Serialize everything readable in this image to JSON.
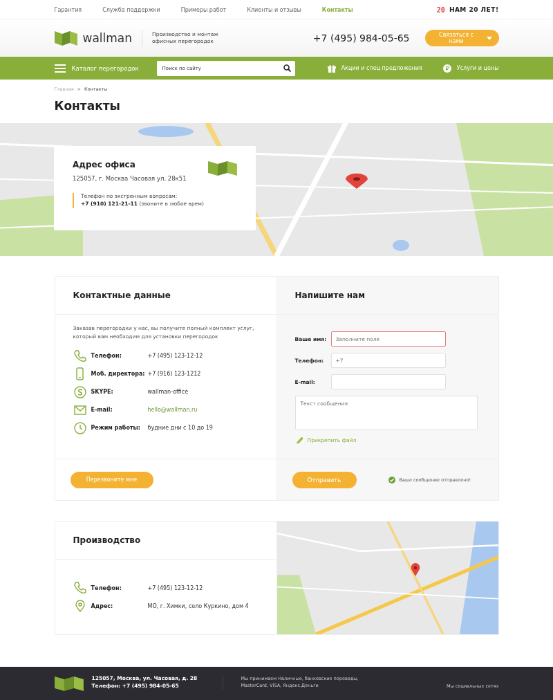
{
  "top_nav": {
    "items": [
      {
        "label": "Гарантия",
        "selected": false
      },
      {
        "label": "Служба поддержки",
        "selected": false
      },
      {
        "label": "Примеры работ",
        "selected": false
      },
      {
        "label": "Клиенты и отзывы",
        "selected": false
      },
      {
        "label": "Контакты",
        "selected": true
      }
    ],
    "anniversary": {
      "badge": "20",
      "text": "НАМ 20 ЛЕТ!"
    }
  },
  "header": {
    "logo_text": "wallman",
    "tagline": "Производство и монтаж офисных перегородок",
    "phone": "+7 (495) 984-05-65",
    "contact_button": "Связаться с нами"
  },
  "nav_bar": {
    "catalog": "Каталог перегородок",
    "search": {
      "placeholder": "Поиск по сайту"
    },
    "links": [
      {
        "label": "Акции и спец предложения",
        "kind": "gift"
      },
      {
        "label": "Услуги и цены",
        "kind": "ruble"
      }
    ]
  },
  "breadcrumb": [
    {
      "label": "Главная",
      "selected": false
    },
    {
      "label": "Контакты",
      "selected": true
    }
  ],
  "breadcrumb_separator": ">",
  "page_title": "Контакты",
  "office_card": {
    "title": "Адрес офиса",
    "address": "125057, г. Москва Часовая ул, 28к51",
    "emergency_label": "Телефон по экстренным вопросам:",
    "emergency_phone": "**+7 (910) 121-21-11** (звоните в любое врем)"
  },
  "contacts": {
    "title": "Контактные данные",
    "intro": "Заказав перегородки у нас, вы получите полный комплект услуг, который вам необходим для установки перегородок",
    "rows": [
      {
        "kind": "phone",
        "label": "Телефон:",
        "value": "+7 (495) 123-12-12"
      },
      {
        "kind": "mobile",
        "label": "Моб. директора:",
        "value": "+7 (916) 123-1212"
      },
      {
        "kind": "skype",
        "label": "SKYPE:",
        "value": "wallman-office"
      },
      {
        "kind": "email",
        "label": "E-mail:",
        "value": "hello@wallman.ru"
      },
      {
        "kind": "clock",
        "label": "Режим работы:",
        "value": "будние дни с 10 до 19"
      }
    ],
    "callback_button": "Перезвоните мне"
  },
  "form": {
    "title": "Напишите нам",
    "fields": [
      {
        "label": "Ваше имя:",
        "placeholder": "Заполните поле",
        "error": true
      },
      {
        "label": "Телефон:",
        "placeholder": "+7",
        "error": false
      },
      {
        "label": "E-mail:",
        "error": false
      }
    ],
    "message": {
      "placeholder": "Текст сообщения"
    },
    "attach": "Прикрепить файл",
    "submit": "Отправить",
    "success": "Ваше сообщение отправлено!"
  },
  "production": {
    "title": "Производство",
    "rows": [
      {
        "kind": "phone",
        "label": "Телефон:",
        "value": "+7 (495) 123-12-12"
      },
      {
        "kind": "pin",
        "label": "Адрес:",
        "value": "МО, г. Химки, село Куркино, дом 4"
      }
    ]
  },
  "footer": {
    "address": "125057, Москва, ул. Часовая, д. 28",
    "phone": "Телефон: +7 (495) 984-05-65",
    "payments": "Мы принимаем Наличные, банковские переводы, MasterCard, VISA, Яндекс.Деньги",
    "social": "Мы социальных сетях"
  }
}
